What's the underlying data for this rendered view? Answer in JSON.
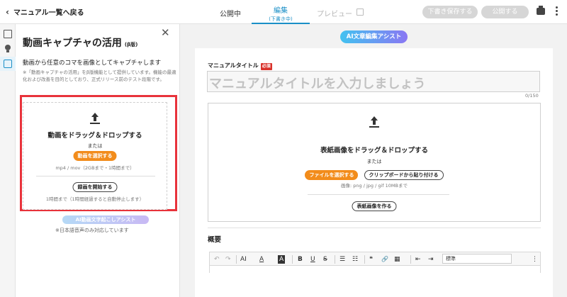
{
  "header": {
    "back_label": "マニュアル一覧へ戻る",
    "tab_published": "公開中",
    "tab_edit": "編集",
    "tab_edit_sub": "(下書き中)",
    "tab_preview": "プレビュー",
    "save_draft": "下書き保存する",
    "publish": "公開する"
  },
  "rail": {
    "icons": [
      "book-icon",
      "lightbulb-icon",
      "capture-icon"
    ]
  },
  "panel": {
    "title": "動画キャプチャの活用",
    "beta": "(β版)",
    "description": "動画から任意のコマを画像としてキャプチャします",
    "note": "※「動画キャプチャの活用」をβ版機能として提供しています。機能の最適化および改善を目的としており、正式リリース前のテスト段階です。",
    "drop_text": "動画をドラッグ＆ドロップする",
    "or_text": "または",
    "select_video": "動画を選択する",
    "format_hint": "mp4 / mov（2GBまで・1時間まで）",
    "start_recording": "録画を開始する",
    "record_hint": "1時間まで（1時間経過すると自動停止します）",
    "assist_label": "AI動画文字起こしアシスト",
    "assist_note": "※日本語音声のみ対応しています"
  },
  "main": {
    "ai_assist": "AI文章編集アシスト",
    "title_label": "マニュアルタイトル",
    "required": "必須",
    "title_placeholder": "マニュアルタイトルを入力しましょう",
    "counter": "0/150",
    "cover_drop": "表紙画像をドラッグ＆ドロップする",
    "or_text": "または",
    "select_file": "ファイルを選択する",
    "paste_clipboard": "クリップボードから貼り付ける",
    "image_hint": "画像: png / jpg / gif 10MBまで",
    "make_cover": "表紙画像を作る",
    "overview_label": "概要",
    "toolbar": {
      "undo": "↶",
      "redo": "↷",
      "font_size": "AI",
      "font_color": "A",
      "highlight": "A",
      "bold": "B",
      "underline": "U",
      "strike": "S",
      "bullet": "☰",
      "numbered": "☷",
      "quote": "❝",
      "link": "🔗",
      "table": "▦",
      "outdent": "⇤",
      "indent": "⇥",
      "style_select": "標準",
      "more": "⋮"
    }
  }
}
